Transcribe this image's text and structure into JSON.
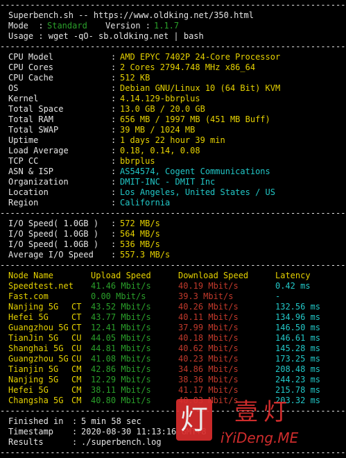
{
  "header": {
    "title": "Superbench.sh -- https://www.oldking.net/350.html",
    "mode_label": "Mode  :",
    "mode_value": "Standard",
    "version_label": "Version :",
    "version_value": "1.1.7",
    "usage": "Usage : wget -qO- sb.oldking.net | bash"
  },
  "separator": "----------------------------------------------------------------------",
  "sysinfo": [
    {
      "label": "CPU Model",
      "value": "AMD EPYC 7402P 24-Core Processor"
    },
    {
      "label": "CPU Cores",
      "value": "2 Cores 2794.748 MHz x86_64"
    },
    {
      "label": "CPU Cache",
      "value": "512 KB"
    },
    {
      "label": "OS",
      "value": "Debian GNU/Linux 10 (64 Bit) KVM"
    },
    {
      "label": "Kernel",
      "value": "4.14.129-bbrplus"
    },
    {
      "label": "Total Space",
      "value": "13.0 GB / 20.0 GB"
    },
    {
      "label": "Total RAM",
      "value": "656 MB / 1997 MB (451 MB Buff)"
    },
    {
      "label": "Total SWAP",
      "value": "39 MB / 1024 MB"
    },
    {
      "label": "Uptime",
      "value": "1 days 22 hour 39 min"
    },
    {
      "label": "Load Average",
      "value": "0.18, 0.14, 0.08"
    },
    {
      "label": "TCP CC",
      "value": "bbrplus"
    },
    {
      "label": "ASN & ISP",
      "value": "AS54574, Cogent Communications"
    },
    {
      "label": "Organization",
      "value": "DMIT-INC - DMIT Inc"
    },
    {
      "label": "Location",
      "value": "Los Angeles, United States / US"
    },
    {
      "label": "Region",
      "value": "California"
    }
  ],
  "io": [
    {
      "label": "I/O Speed( 1.0GB )",
      "value": "572 MB/s"
    },
    {
      "label": "I/O Speed( 1.0GB )",
      "value": "564 MB/s"
    },
    {
      "label": "I/O Speed( 1.0GB )",
      "value": "536 MB/s"
    },
    {
      "label": "Average I/O Speed",
      "value": "557.3 MB/s"
    }
  ],
  "speedtest": {
    "headers": [
      "Node Name",
      "Upload Speed",
      "Download Speed",
      "Latency"
    ],
    "rows": [
      {
        "node": "Speedtest.net",
        "isp": "",
        "up": "41.46 Mbit/s",
        "down": "40.19 Mbit/s",
        "lat": "0.42 ms"
      },
      {
        "node": "Fast.com",
        "isp": "",
        "up": "0.00 Mbit/s",
        "down": "39.3 Mbit/s",
        "lat": "-"
      },
      {
        "node": "Nanjing 5G",
        "isp": "CT",
        "up": "43.52 Mbit/s",
        "down": "40.26 Mbit/s",
        "lat": "132.56 ms"
      },
      {
        "node": "Hefei 5G",
        "isp": "CT",
        "up": "43.77 Mbit/s",
        "down": "40.11 Mbit/s",
        "lat": "134.96 ms"
      },
      {
        "node": "Guangzhou 5G",
        "isp": "CT",
        "up": "12.41 Mbit/s",
        "down": "37.99 Mbit/s",
        "lat": "146.50 ms"
      },
      {
        "node": "TianJin 5G",
        "isp": "CU",
        "up": "44.05 Mbit/s",
        "down": "40.18 Mbit/s",
        "lat": "146.61 ms"
      },
      {
        "node": "Shanghai 5G",
        "isp": "CU",
        "up": "44.81 Mbit/s",
        "down": "40.62 Mbit/s",
        "lat": "145.28 ms"
      },
      {
        "node": "Guangzhou 5G",
        "isp": "CU",
        "up": "41.08 Mbit/s",
        "down": "40.23 Mbit/s",
        "lat": "173.25 ms"
      },
      {
        "node": "Tianjin 5G",
        "isp": "CM",
        "up": "42.86 Mbit/s",
        "down": "34.86 Mbit/s",
        "lat": "208.48 ms"
      },
      {
        "node": "Nanjing 5G",
        "isp": "CM",
        "up": "12.29 Mbit/s",
        "down": "38.36 Mbit/s",
        "lat": "244.23 ms"
      },
      {
        "node": "Hefei 5G",
        "isp": "CM",
        "up": "38.11 Mbit/s",
        "down": "41.17 Mbit/s",
        "lat": "215.78 ms"
      },
      {
        "node": "Changsha 5G",
        "isp": "CM",
        "up": "40.80 Mbit/s",
        "down": "40.03 Mbit/s",
        "lat": "203.32 ms"
      }
    ]
  },
  "footer": [
    {
      "label": "Finished in",
      "value": "5 min 58 sec"
    },
    {
      "label": "Timestamp",
      "value": "2020-08-30 11:13:16 GMT+8"
    },
    {
      "label": "Results",
      "value": "./superbench.log"
    }
  ],
  "watermark": {
    "icon_char": "灯",
    "title": "壹灯",
    "subtitle": "iYiDeng.ME"
  },
  "colors": {
    "background": "#000000",
    "text": "#e6e6e6",
    "yellow": "#e6d200",
    "cyan": "#22c8c8",
    "green": "#2aa02a",
    "red": "#c0392b",
    "watermark": "#e03030"
  }
}
